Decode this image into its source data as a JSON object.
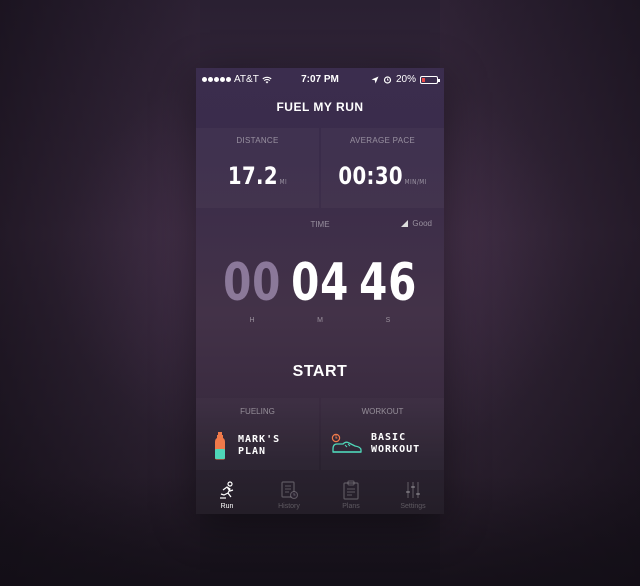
{
  "status_bar": {
    "carrier": "AT&T",
    "time": "7:07 PM",
    "battery": "20%",
    "battery_level": 0.2,
    "signal_bars": 5
  },
  "app": {
    "title": "FUEL MY RUN"
  },
  "stats": {
    "distance": {
      "label": "DISTANCE",
      "value": "17.2",
      "unit": "MI"
    },
    "pace": {
      "label": "AVERAGE PACE",
      "value": "00:30",
      "unit": "MIN/MI"
    }
  },
  "time": {
    "label": "TIME",
    "signal_status": "Good",
    "hours": "00",
    "minutes": "04",
    "seconds": "46",
    "hours_letter": "H",
    "minutes_letter": "M",
    "seconds_letter": "S"
  },
  "start_label": "START",
  "fueling": {
    "label": "FUELING",
    "title_line1": "MARK'S",
    "title_line2": "PLAN",
    "icon": "bottle-icon"
  },
  "workout": {
    "label": "WORKOUT",
    "title_line1": "BASIC",
    "title_line2": "WORKOUT",
    "icon": "shoe-icon"
  },
  "tabs": [
    {
      "label": "Run",
      "icon": "runner-icon",
      "active": true
    },
    {
      "label": "History",
      "icon": "history-icon",
      "active": false
    },
    {
      "label": "Plans",
      "icon": "clipboard-icon",
      "active": false
    },
    {
      "label": "Settings",
      "icon": "sliders-icon",
      "active": false
    }
  ],
  "colors": {
    "accent_teal": "#4fd6b8",
    "accent_orange": "#f07a4a",
    "battery_low": "#e84a4a"
  }
}
